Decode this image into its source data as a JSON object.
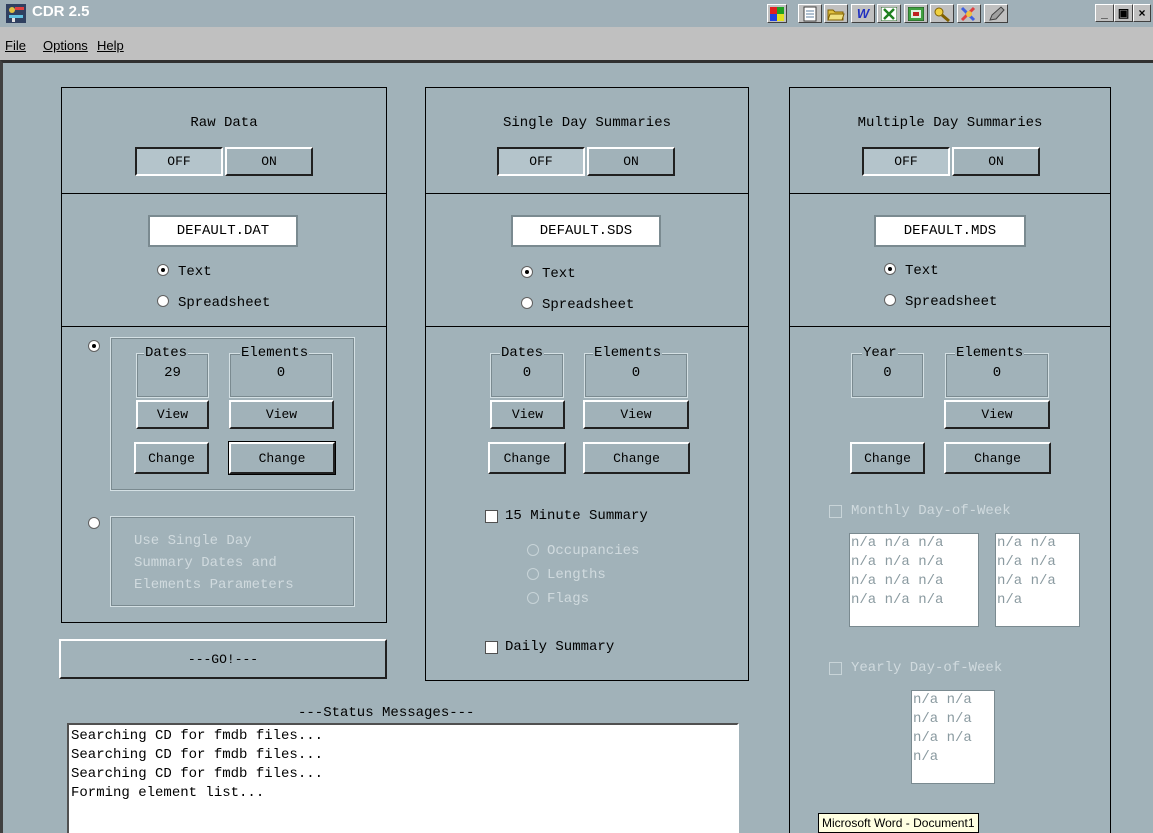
{
  "window": {
    "title": "CDR 2.5"
  },
  "menu": {
    "file": "File",
    "options": "Options",
    "help": "Help"
  },
  "toolbar_icons": [
    "office-color-icon",
    "notepad-icon",
    "folder-open-icon",
    "word-icon",
    "excel-icon",
    "powerpoint-icon",
    "search-key-icon",
    "shortcut-tool-icon",
    "pen-icon"
  ],
  "window_buttons": {
    "minimize": "_",
    "maximize": "▣",
    "close": "×"
  },
  "toggle": {
    "off": "OFF",
    "on": "ON"
  },
  "raw": {
    "heading": "Raw Data",
    "file": "DEFAULT.DAT",
    "text": "Text",
    "spreadsheet": "Spreadsheet",
    "dates_title": "Dates",
    "dates_value": "29",
    "elements_title": "Elements",
    "elements_value": "0",
    "view": "View",
    "change": "Change",
    "use_single_day": "Use Single Day\nSummary Dates and\nElements Parameters",
    "go": "---GO!---"
  },
  "sds": {
    "heading": "Single Day Summaries",
    "file": "DEFAULT.SDS",
    "text": "Text",
    "spreadsheet": "Spreadsheet",
    "dates_title": "Dates",
    "dates_value": "0",
    "elements_title": "Elements",
    "elements_value": "0",
    "view": "View",
    "change": "Change",
    "fifteen": "15 Minute Summary",
    "occupancies": "Occupancies",
    "lengths": "Lengths",
    "flags": "Flags",
    "daily": "Daily Summary"
  },
  "mds": {
    "heading": "Multiple Day Summaries",
    "file": "DEFAULT.MDS",
    "text": "Text",
    "spreadsheet": "Spreadsheet",
    "year_title": "Year",
    "year_value": "0",
    "elements_title": "Elements",
    "elements_value": "0",
    "view": "View",
    "change": "Change",
    "monthly": "Monthly Day-of-Week",
    "monthly_left": "n/a n/a n/a\nn/a n/a n/a\nn/a n/a n/a\nn/a n/a n/a",
    "monthly_right": "n/a n/a\nn/a n/a\nn/a n/a\nn/a",
    "yearly": "Yearly Day-of-Week",
    "yearly_list": "n/a n/a\nn/a n/a\nn/a n/a\nn/a"
  },
  "status": {
    "heading": "---Status Messages---",
    "lines": "Searching CD for fmdb files...\nSearching CD for fmdb files...\nSearching CD for fmdb files...\nForming element list..."
  },
  "tooltip": "Microsoft Word - Document1"
}
